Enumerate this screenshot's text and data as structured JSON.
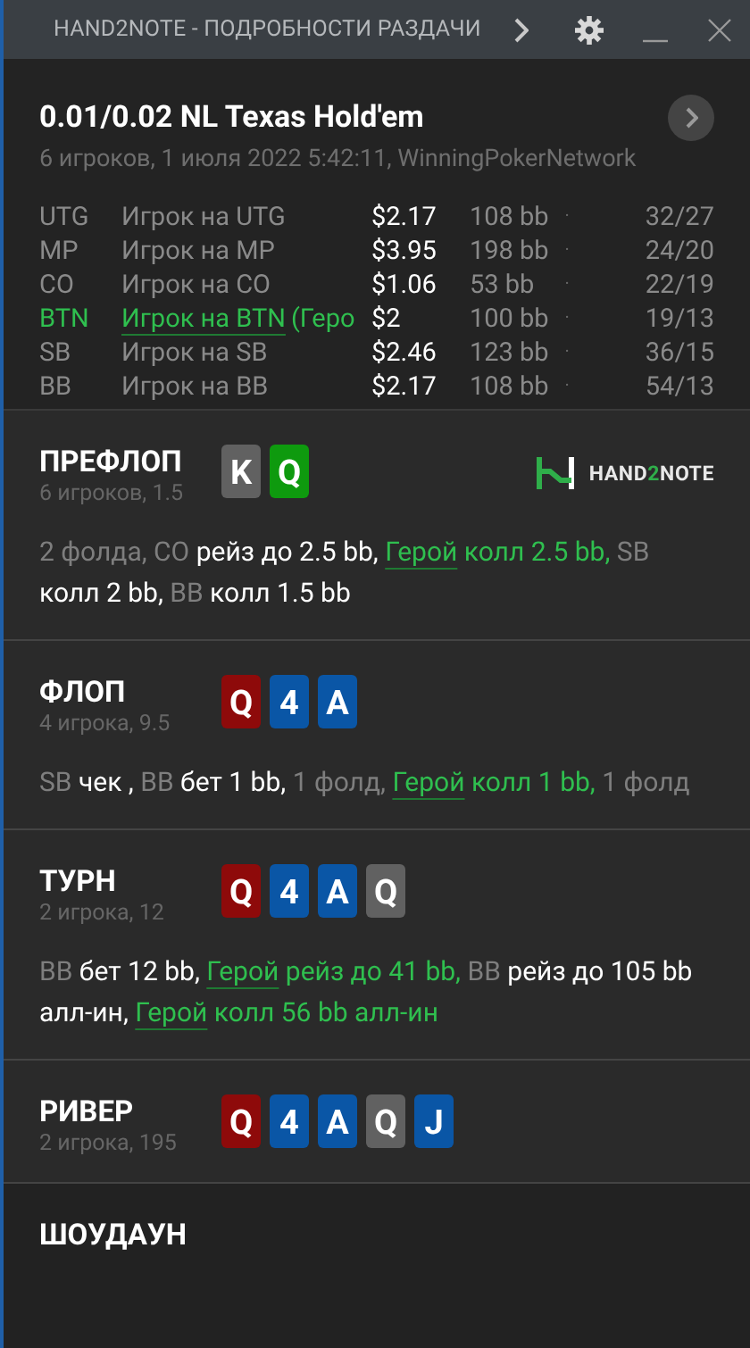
{
  "window": {
    "title": "HAND2NOTE - ПОДРОБНОСТИ РАЗДАЧИ",
    "buttons": [
      {
        "kind": "next"
      },
      {
        "kind": "settings"
      },
      {
        "kind": "minimize"
      },
      {
        "kind": "close"
      }
    ]
  },
  "hand": {
    "title": "0.01/0.02 NL Texas Hold'em",
    "subtitle": "6 игроков, 1 июля 2022 5:42:11, WinningPokerNetwork",
    "players": [
      {
        "position": "UTG",
        "name": "Игрок на UTG",
        "hero": false,
        "stack": "$2.17",
        "bb": "108 bb",
        "sep": "·",
        "stats": "32/27"
      },
      {
        "position": "MP",
        "name": "Игрок на MP",
        "hero": false,
        "stack": "$3.95",
        "bb": "198 bb",
        "sep": "·",
        "stats": "24/20"
      },
      {
        "position": "CO",
        "name": "Игрок на CO",
        "hero": false,
        "stack": "$1.06",
        "bb": "53 bb",
        "sep": "·",
        "stats": "22/19"
      },
      {
        "position": "BTN",
        "name": "Игрок на BTN",
        "suffix": "(Геро",
        "hero": true,
        "stack": "$2",
        "bb": "100 bb",
        "sep": "·",
        "stats": "19/13"
      },
      {
        "position": "SB",
        "name": "Игрок на SB",
        "hero": false,
        "stack": "$2.46",
        "bb": "123 bb",
        "sep": "·",
        "stats": "36/15"
      },
      {
        "position": "BB",
        "name": "Игрок на BB",
        "hero": false,
        "stack": "$2.17",
        "bb": "108 bb",
        "sep": "·",
        "stats": "54/13"
      }
    ]
  },
  "streets": [
    {
      "title": "ПРЕФЛОП",
      "info": "6 игроков, 1.5",
      "logo": {
        "text": "HAND",
        "digit": "2",
        "rest": "NOTE"
      },
      "cards": [
        {
          "rank": "K",
          "color": "#616161"
        },
        {
          "rank": "Q",
          "color": "#0e9a0e"
        }
      ],
      "actions": [
        {
          "kind": "muted",
          "text": "2 фолда, CO "
        },
        {
          "kind": "plain",
          "text": "рейз до 2.5 bb, "
        },
        {
          "kind": "link",
          "text": "Герой"
        },
        {
          "kind": "hero",
          "text": " колл 2.5 bb, "
        },
        {
          "kind": "muted",
          "text": "SB "
        },
        {
          "kind": "plain",
          "text": "колл 2 bb, "
        },
        {
          "kind": "muted",
          "text": "BB "
        },
        {
          "kind": "plain",
          "text": "колл 1.5 bb"
        }
      ]
    },
    {
      "title": "ФЛОП",
      "info": "4 игрока, 9.5",
      "cards": [
        {
          "rank": "Q",
          "color": "#8e0a0a"
        },
        {
          "rank": "4",
          "color": "#0a56a6"
        },
        {
          "rank": "A",
          "color": "#0a56a6"
        }
      ],
      "actions": [
        {
          "kind": "muted",
          "text": "SB "
        },
        {
          "kind": "plain",
          "text": "чек , "
        },
        {
          "kind": "muted",
          "text": "BB "
        },
        {
          "kind": "plain",
          "text": "бет 1 bb, "
        },
        {
          "kind": "muted",
          "text": "1 фолд, "
        },
        {
          "kind": "link",
          "text": "Герой"
        },
        {
          "kind": "hero",
          "text": " колл 1 bb, "
        },
        {
          "kind": "muted",
          "text": "1 фолд"
        }
      ]
    },
    {
      "title": "ТУРН",
      "info": "2 игрока, 12",
      "cards": [
        {
          "rank": "Q",
          "color": "#8e0a0a"
        },
        {
          "rank": "4",
          "color": "#0a56a6"
        },
        {
          "rank": "A",
          "color": "#0a56a6"
        },
        {
          "rank": "Q",
          "color": "#616161"
        }
      ],
      "actions": [
        {
          "kind": "muted",
          "text": "BB "
        },
        {
          "kind": "plain",
          "text": "бет 12 bb, "
        },
        {
          "kind": "link",
          "text": "Герой"
        },
        {
          "kind": "hero",
          "text": " рейз до 41 bb, "
        },
        {
          "kind": "muted",
          "text": "BB "
        },
        {
          "kind": "plain",
          "text": "рейз до 105 bb алл-ин, "
        },
        {
          "kind": "link",
          "text": "Герой"
        },
        {
          "kind": "hero",
          "text": " колл 56 bb алл-ин"
        }
      ]
    },
    {
      "title": "РИВЕР",
      "info": "2 игрока, 195",
      "cards": [
        {
          "rank": "Q",
          "color": "#8e0a0a"
        },
        {
          "rank": "4",
          "color": "#0a56a6"
        },
        {
          "rank": "A",
          "color": "#0a56a6"
        },
        {
          "rank": "Q",
          "color": "#616161"
        },
        {
          "rank": "J",
          "color": "#0a56a6"
        }
      ]
    }
  ],
  "showdown": {
    "title": "ШОУДАУН"
  }
}
